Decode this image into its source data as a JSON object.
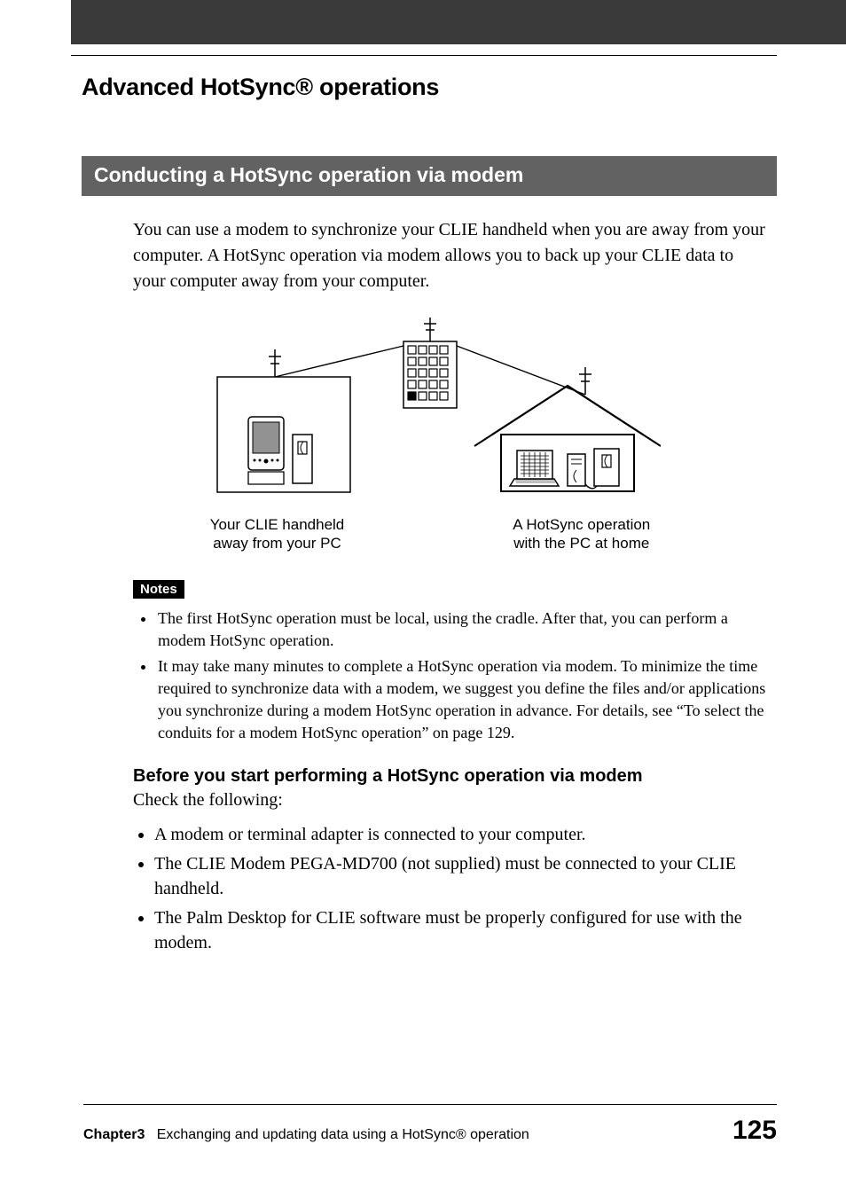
{
  "header": {
    "title": "Advanced HotSync® operations"
  },
  "section": {
    "title": "Conducting a HotSync operation via modem",
    "intro": "You can use a modem to synchronize your CLIE handheld when you are away from your computer. A HotSync operation via modem allows you to back up your CLIE data to your computer away from your computer."
  },
  "diagram": {
    "caption_left": "Your CLIE handheld\naway from your PC",
    "caption_right": "A HotSync operation\nwith the PC at home"
  },
  "notes": {
    "label": "Notes",
    "items": [
      "The first HotSync operation must be local, using the cradle. After that, you can perform a modem HotSync operation.",
      "It may take many minutes to complete a HotSync operation via modem. To minimize the time required to synchronize data with a modem, we suggest you define the files and/or applications you synchronize during a modem HotSync operation in advance. For details, see “To select the conduits for a modem HotSync operation” on page 129."
    ]
  },
  "before": {
    "heading": "Before you start performing a HotSync operation via modem",
    "lead": "Check the following:",
    "bullets": [
      "A modem or terminal adapter is connected to your computer.",
      "The CLIE Modem PEGA-MD700 (not supplied) must be connected to your CLIE handheld.",
      "The Palm Desktop for CLIE software must be properly configured for use with the modem."
    ]
  },
  "footer": {
    "chapter_label": "Chapter3",
    "chapter_text": "Exchanging and updating data using a HotSync® operation",
    "page_number": "125"
  }
}
